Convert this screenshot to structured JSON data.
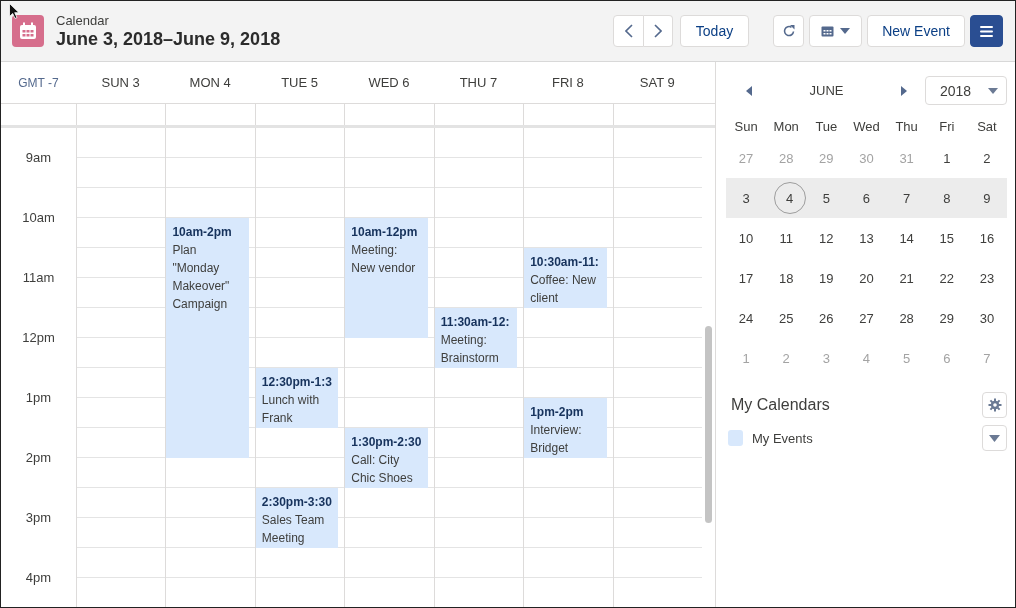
{
  "header": {
    "app_label": "Calendar",
    "title": "June 3, 2018–June 9, 2018",
    "today_button": "Today",
    "new_event_button": "New Event"
  },
  "week": {
    "timezone": "GMT -7",
    "days": [
      {
        "label": "SUN 3"
      },
      {
        "label": "MON 4",
        "events": [
          {
            "time": "10am-2pm",
            "title": "Plan \"Monday Makeover\" Campaign"
          }
        ]
      },
      {
        "label": "TUE 5",
        "events": [
          {
            "time": "12:30pm-1:3",
            "title": "Lunch with Frank"
          },
          {
            "time": "2:30pm-3:30",
            "title": "Sales Team Meeting"
          }
        ]
      },
      {
        "label": "WED 6",
        "events": [
          {
            "time": "10am-12pm",
            "title": "Meeting: New vendor"
          },
          {
            "time": "1:30pm-2:30",
            "title": "Call: City Chic Shoes"
          }
        ]
      },
      {
        "label": "THU 7",
        "events": [
          {
            "time": "11:30am-12:",
            "title": "Meeting: Brainstorm"
          }
        ]
      },
      {
        "label": "FRI 8",
        "events": [
          {
            "time": "10:30am-11:",
            "title": "Coffee: New client"
          },
          {
            "time": "1pm-2pm",
            "title": "Interview: Bridget"
          }
        ]
      },
      {
        "label": "SAT 9"
      }
    ],
    "hours": [
      "9am",
      "10am",
      "11am",
      "12pm",
      "1pm",
      "2pm",
      "3pm",
      "4pm"
    ]
  },
  "mini_calendar": {
    "month": "JUNE",
    "year": "2018",
    "weekdays": [
      "Sun",
      "Mon",
      "Tue",
      "Wed",
      "Thu",
      "Fri",
      "Sat"
    ],
    "weeks": [
      {
        "selected": false,
        "days": [
          {
            "label": "27",
            "muted": true,
            "today": false
          },
          {
            "label": "28",
            "muted": true,
            "today": false
          },
          {
            "label": "29",
            "muted": true,
            "today": false
          },
          {
            "label": "30",
            "muted": true,
            "today": false
          },
          {
            "label": "31",
            "muted": true,
            "today": false
          },
          {
            "label": "1",
            "muted": false,
            "today": false
          },
          {
            "label": "2",
            "muted": false,
            "today": false
          }
        ]
      },
      {
        "selected": true,
        "days": [
          {
            "label": "3",
            "muted": false,
            "today": false
          },
          {
            "label": "4",
            "muted": false,
            "today": true
          },
          {
            "label": "5",
            "muted": false,
            "today": false
          },
          {
            "label": "6",
            "muted": false,
            "today": false
          },
          {
            "label": "7",
            "muted": false,
            "today": false
          },
          {
            "label": "8",
            "muted": false,
            "today": false
          },
          {
            "label": "9",
            "muted": false,
            "today": false
          }
        ]
      },
      {
        "selected": false,
        "days": [
          {
            "label": "10",
            "muted": false,
            "today": false
          },
          {
            "label": "11",
            "muted": false,
            "today": false
          },
          {
            "label": "12",
            "muted": false,
            "today": false
          },
          {
            "label": "13",
            "muted": false,
            "today": false
          },
          {
            "label": "14",
            "muted": false,
            "today": false
          },
          {
            "label": "15",
            "muted": false,
            "today": false
          },
          {
            "label": "16",
            "muted": false,
            "today": false
          }
        ]
      },
      {
        "selected": false,
        "days": [
          {
            "label": "17",
            "muted": false,
            "today": false
          },
          {
            "label": "18",
            "muted": false,
            "today": false
          },
          {
            "label": "19",
            "muted": false,
            "today": false
          },
          {
            "label": "20",
            "muted": false,
            "today": false
          },
          {
            "label": "21",
            "muted": false,
            "today": false
          },
          {
            "label": "22",
            "muted": false,
            "today": false
          },
          {
            "label": "23",
            "muted": false,
            "today": false
          }
        ]
      },
      {
        "selected": false,
        "days": [
          {
            "label": "24",
            "muted": false,
            "today": false
          },
          {
            "label": "25",
            "muted": false,
            "today": false
          },
          {
            "label": "26",
            "muted": false,
            "today": false
          },
          {
            "label": "27",
            "muted": false,
            "today": false
          },
          {
            "label": "28",
            "muted": false,
            "today": false
          },
          {
            "label": "29",
            "muted": false,
            "today": false
          },
          {
            "label": "30",
            "muted": false,
            "today": false
          }
        ]
      },
      {
        "selected": false,
        "days": [
          {
            "label": "1",
            "muted": true,
            "today": false
          },
          {
            "label": "2",
            "muted": true,
            "today": false
          },
          {
            "label": "3",
            "muted": true,
            "today": false
          },
          {
            "label": "4",
            "muted": true,
            "today": false
          },
          {
            "label": "5",
            "muted": true,
            "today": false
          },
          {
            "label": "6",
            "muted": true,
            "today": false
          },
          {
            "label": "7",
            "muted": true,
            "today": false
          }
        ]
      }
    ]
  },
  "my_calendars": {
    "title": "My Calendars",
    "items": [
      {
        "label": "My Events",
        "color": "#d8e8fc"
      }
    ]
  }
}
